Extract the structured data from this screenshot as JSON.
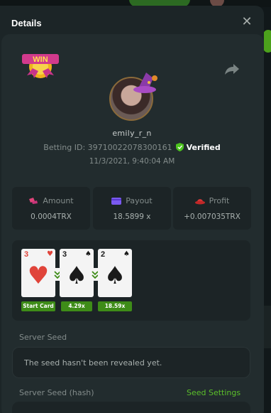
{
  "modal": {
    "title": "Details"
  },
  "player": {
    "username": "emily_r_n",
    "betting_id_label": "Betting ID:",
    "betting_id": "39710022078300161",
    "verified_label": "Verified",
    "datetime": "11/3/2021, 9:40:04 AM",
    "badge_text": "WIN"
  },
  "stats": [
    {
      "label": "Amount",
      "value": "0.0004TRX",
      "icon": "coins-icon"
    },
    {
      "label": "Payout",
      "value": "18.5899 x",
      "icon": "wallet-icon"
    },
    {
      "label": "Profit",
      "value": "+0.007035TRX",
      "icon": "hat-icon"
    }
  ],
  "cards": [
    {
      "rank": "3",
      "suit": "♥",
      "color": "red",
      "label": "Start Card"
    },
    {
      "rank": "3",
      "suit": "♠",
      "color": "black",
      "label": "4.29x"
    },
    {
      "rank": "2",
      "suit": "♠",
      "color": "black",
      "label": "18.59x"
    }
  ],
  "seeds": {
    "server_seed_label": "Server Seed",
    "server_seed_value": "The seed hasn't been revealed yet.",
    "server_seed_hash_label": "Server Seed (hash)",
    "seed_settings_label": "Seed Settings"
  },
  "colors": {
    "accent_green": "#5bbf2a",
    "label_green": "#3e8c18",
    "panel": "#1c2426",
    "modal": "#222c2e"
  }
}
